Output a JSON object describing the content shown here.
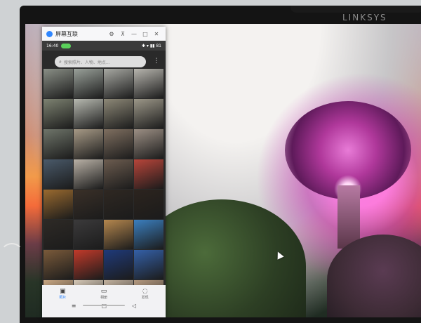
{
  "bezel": {
    "brand": "LINKSYS"
  },
  "window": {
    "title": "屏幕互联"
  },
  "phone": {
    "status": {
      "time": "16:40",
      "right": "✱ ▾ ▮▮ 81"
    },
    "search": {
      "placeholder": "搜索照片、人物、地点..."
    },
    "nav": {
      "tabs": [
        {
          "label": "照片",
          "icon": "photo-icon"
        },
        {
          "label": "相册",
          "icon": "album-icon"
        },
        {
          "label": "发现",
          "icon": "discover-icon"
        }
      ]
    }
  },
  "colors": {
    "accent": "#2f86ff",
    "status_pill": "#5ad05a"
  },
  "thumbnails": [
    {
      "name": "photo-thumb",
      "bg": "#8a8f86"
    },
    {
      "name": "photo-thumb",
      "bg": "#9aa19a"
    },
    {
      "name": "photo-thumb",
      "bg": "#a7a8a2"
    },
    {
      "name": "photo-thumb",
      "bg": "#b7b5ae"
    },
    {
      "name": "photo-thumb",
      "bg": "#7d8271"
    },
    {
      "name": "photo-thumb",
      "bg": "#b7b9b0"
    },
    {
      "name": "photo-thumb",
      "bg": "#8d8877"
    },
    {
      "name": "photo-thumb",
      "bg": "#9c9788"
    },
    {
      "name": "photo-thumb",
      "bg": "#6f756a"
    },
    {
      "name": "photo-thumb",
      "bg": "#a79a86"
    },
    {
      "name": "photo-thumb",
      "bg": "#7f6f60"
    },
    {
      "name": "photo-thumb",
      "bg": "#9c8f84"
    },
    {
      "name": "photo-thumb",
      "bg": "#4a5a6a"
    },
    {
      "name": "photo-thumb",
      "bg": "#b9b1a6"
    },
    {
      "name": "photo-thumb",
      "bg": "#6c5c4f"
    },
    {
      "name": "photo-thumb",
      "bg": "#b8453a"
    },
    {
      "name": "photo-thumb",
      "bg": "#9a6a2f"
    },
    {
      "name": "photo-thumb",
      "bg": "#3a3028"
    },
    {
      "name": "photo-thumb",
      "bg": "#2f2822"
    },
    {
      "name": "photo-thumb",
      "bg": "#2c241e"
    },
    {
      "name": "photo-thumb",
      "bg": "#2e2a26"
    },
    {
      "name": "photo-thumb",
      "bg": "#3b3a3b"
    },
    {
      "name": "photo-thumb",
      "bg": "#b5874e"
    },
    {
      "name": "photo-thumb",
      "bg": "#3b7fbf"
    },
    {
      "name": "photo-thumb",
      "bg": "#7a5a3a"
    },
    {
      "name": "photo-thumb",
      "bg": "#c23a2a"
    },
    {
      "name": "photo-thumb",
      "bg": "#1f3a7a"
    },
    {
      "name": "photo-thumb",
      "bg": "#3460a8"
    },
    {
      "name": "photo-thumb",
      "bg": "#caa884"
    },
    {
      "name": "photo-thumb",
      "bg": "#d7c9b7"
    },
    {
      "name": "photo-thumb",
      "bg": "#c3b29f"
    },
    {
      "name": "photo-thumb",
      "bg": "#b59a80"
    }
  ]
}
